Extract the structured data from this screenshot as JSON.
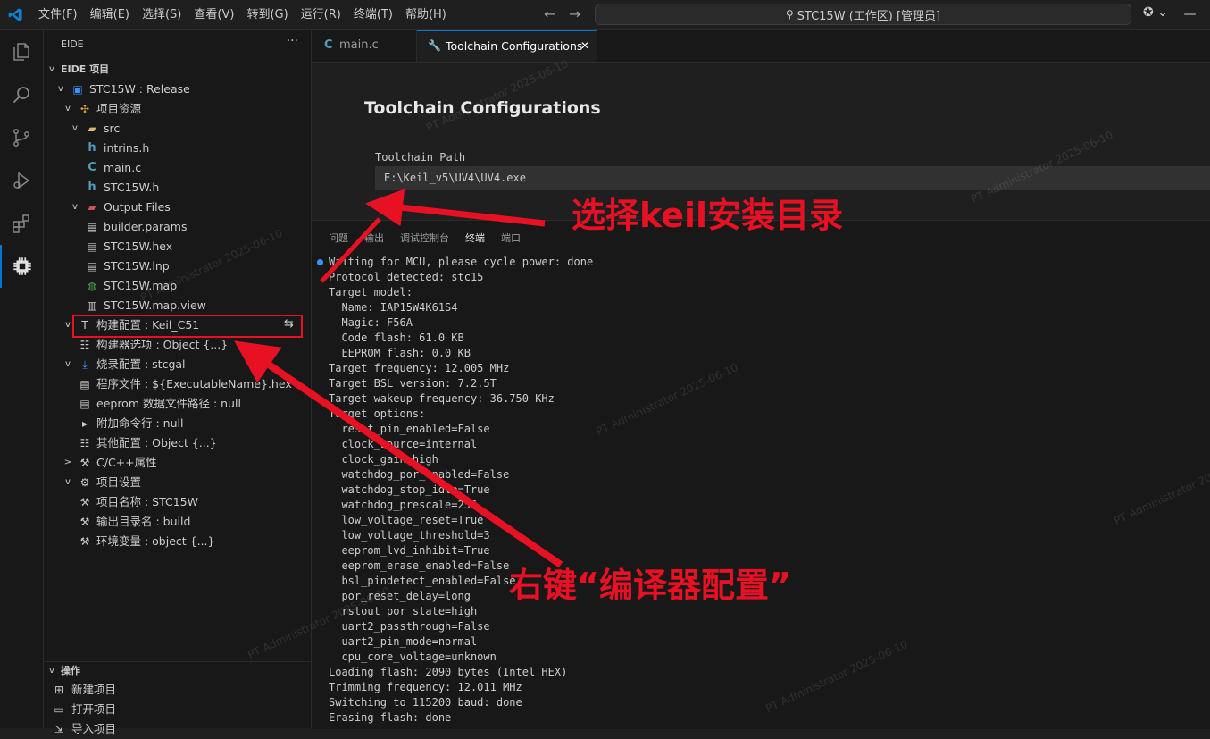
{
  "titlebar": {
    "menu": [
      "文件(F)",
      "编辑(E)",
      "选择(S)",
      "查看(V)",
      "转到(G)",
      "运行(R)",
      "终端(T)",
      "帮助(H)"
    ],
    "search_text": "STC15W (工作区) [管理员]",
    "back_arrow": "←",
    "forward_arrow": "→",
    "window_controls": [
      "—",
      "☐",
      "✕"
    ]
  },
  "icons": {
    "activity": [
      "explorer-icon",
      "search-icon",
      "source-control-icon",
      "run-debug-icon",
      "extensions-icon",
      "eide-chip-icon"
    ]
  },
  "colors": {
    "accent": "#0078d4",
    "annotation_red": "#e81123",
    "terminal_dot": "#3794ff"
  },
  "sidebar": {
    "header": "EIDE",
    "more": "···",
    "section_title": "EIDE 项目",
    "tree": [
      {
        "label": "STC15W : Release",
        "indent": 0,
        "chev": "v",
        "icon": "project-icon"
      },
      {
        "label": "项目资源",
        "indent": 1,
        "chev": "v",
        "icon": "resources-icon"
      },
      {
        "label": "src",
        "indent": 2,
        "chev": "v",
        "icon": "folder-icon"
      },
      {
        "label": "intrins.h",
        "indent": 3,
        "chev": "",
        "icon": "header-file-icon"
      },
      {
        "label": "main.c",
        "indent": 3,
        "chev": "",
        "icon": "c-file-icon"
      },
      {
        "label": "STC15W.h",
        "indent": 3,
        "chev": "",
        "icon": "header-file-icon"
      },
      {
        "label": "Output Files",
        "indent": 2,
        "chev": "v",
        "icon": "output-folder-icon"
      },
      {
        "label": "builder.params",
        "indent": 3,
        "chev": "",
        "icon": "file-icon"
      },
      {
        "label": "STC15W.hex",
        "indent": 3,
        "chev": "",
        "icon": "file-icon"
      },
      {
        "label": "STC15W.lnp",
        "indent": 3,
        "chev": "",
        "icon": "file-icon"
      },
      {
        "label": "STC15W.map",
        "indent": 3,
        "chev": "",
        "icon": "globe-icon"
      },
      {
        "label": "STC15W.map.view",
        "indent": 3,
        "chev": "",
        "icon": "chart-file-icon"
      },
      {
        "label": "构建配置 : Keil_C51",
        "indent": 1,
        "chev": "v",
        "icon": "build-config-icon"
      },
      {
        "label": "构建器选项 : Object {...}",
        "indent": 2,
        "chev": "",
        "icon": "options-icon"
      },
      {
        "label": "烧录配置 : stcgal",
        "indent": 1,
        "chev": "v",
        "icon": "flash-icon"
      },
      {
        "label": "程序文件 : ${ExecutableName}.hex",
        "indent": 2,
        "chev": "",
        "icon": "file-icon"
      },
      {
        "label": "eeprom 数据文件路径 : null",
        "indent": 2,
        "chev": "",
        "icon": "file-icon"
      },
      {
        "label": "附加命令行 : null",
        "indent": 2,
        "chev": "",
        "icon": "terminal-icon"
      },
      {
        "label": "其他配置 : Object {...}",
        "indent": 2,
        "chev": "",
        "icon": "options-icon"
      },
      {
        "label": "C/C++属性",
        "indent": 1,
        "chev": ">",
        "icon": "wrench-icon"
      },
      {
        "label": "项目设置",
        "indent": 1,
        "chev": "v",
        "icon": "gear-icon"
      },
      {
        "label": "项目名称 : STC15W",
        "indent": 2,
        "chev": "",
        "icon": "wrench-icon"
      },
      {
        "label": "输出目录名 : build",
        "indent": 2,
        "chev": "",
        "icon": "wrench-icon"
      },
      {
        "label": "环境变量 : object {...}",
        "indent": 2,
        "chev": "",
        "icon": "wrench-icon"
      }
    ],
    "switch_icon": "⇆",
    "ops_title": "操作",
    "ops": [
      {
        "label": "新建项目",
        "icon": "new-project-icon"
      },
      {
        "label": "打开项目",
        "icon": "open-project-icon"
      },
      {
        "label": "导入项目",
        "icon": "import-project-icon"
      }
    ]
  },
  "tabs": [
    {
      "label": "main.c",
      "icon": "C",
      "active": false
    },
    {
      "label": "Toolchain Configurations",
      "icon": "wrench",
      "active": true,
      "close": "✕"
    }
  ],
  "toolchain": {
    "title": "Toolchain Configurations",
    "path_label": "Toolchain Path",
    "path_value": "E:\\Keil_v5\\UV4\\UV4.exe"
  },
  "panel": {
    "tabs": [
      "问题",
      "输出",
      "调试控制台",
      "终端",
      "端口"
    ],
    "active_tab": "终端",
    "terminal": [
      "Waiting for MCU, please cycle power: done",
      "Protocol detected: stc15",
      "Target model:",
      "  Name: IAP15W4K61S4",
      "  Magic: F56A",
      "  Code flash: 61.0 KB",
      "  EEPROM flash: 0.0 KB",
      "Target frequency: 12.005 MHz",
      "Target BSL version: 7.2.5T",
      "Target wakeup frequency: 36.750 KHz",
      "Target options:",
      "  reset_pin_enabled=False",
      "  clock_source=internal",
      "  clock_gain=high",
      "  watchdog_por_enabled=False",
      "  watchdog_stop_idle=True",
      "  watchdog_prescale=256",
      "  low_voltage_reset=True",
      "  low_voltage_threshold=3",
      "  eeprom_lvd_inhibit=True",
      "  eeprom_erase_enabled=False",
      "  bsl_pindetect_enabled=False",
      "  por_reset_delay=long",
      "  rstout_por_state=high",
      "  uart2_passthrough=False",
      "  uart2_pin_mode=normal",
      "  cpu_core_voltage=unknown",
      "Loading flash: 2090 bytes (Intel HEX)",
      "Trimming frequency: 12.011 MHz",
      "Switching to 115200 baud: done",
      "Erasing flash: done"
    ]
  },
  "annotations": {
    "top": "选择keil安装目录",
    "bottom": "右键“编译器配置”"
  },
  "watermark": "PT Administrator 2025-06-10"
}
